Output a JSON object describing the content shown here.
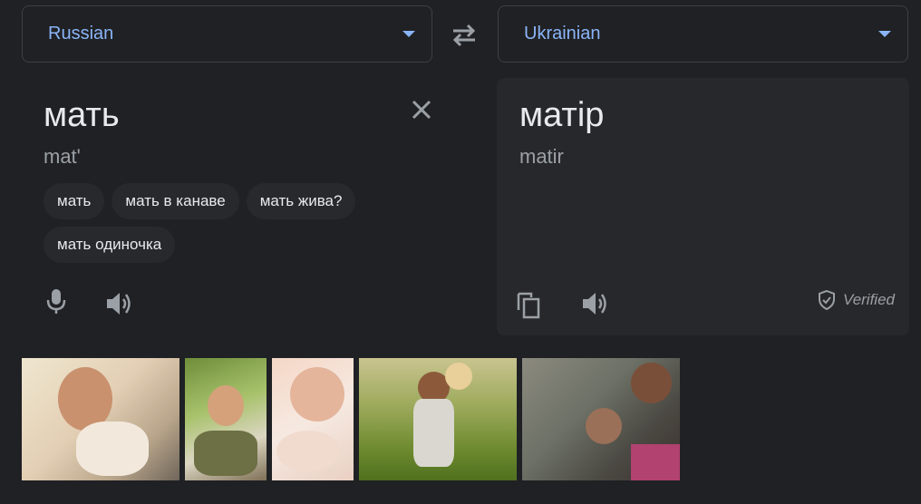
{
  "source_lang": "Russian",
  "target_lang": "Ukrainian",
  "source": {
    "word": "мать",
    "transliteration": "mat'",
    "suggestions": [
      "мать",
      "мать в канаве",
      "мать жива?",
      "мать одиночка"
    ]
  },
  "target": {
    "word": "матір",
    "transliteration": "matir",
    "verified_label": "Verified"
  },
  "colors": {
    "accent": "#8ab4f8",
    "background": "#202124",
    "panel": "#27282b"
  },
  "icons": [
    "chevron-down-icon",
    "swap-icon",
    "close-icon",
    "microphone-icon",
    "speaker-icon",
    "copy-icon",
    "shield-check-icon"
  ]
}
